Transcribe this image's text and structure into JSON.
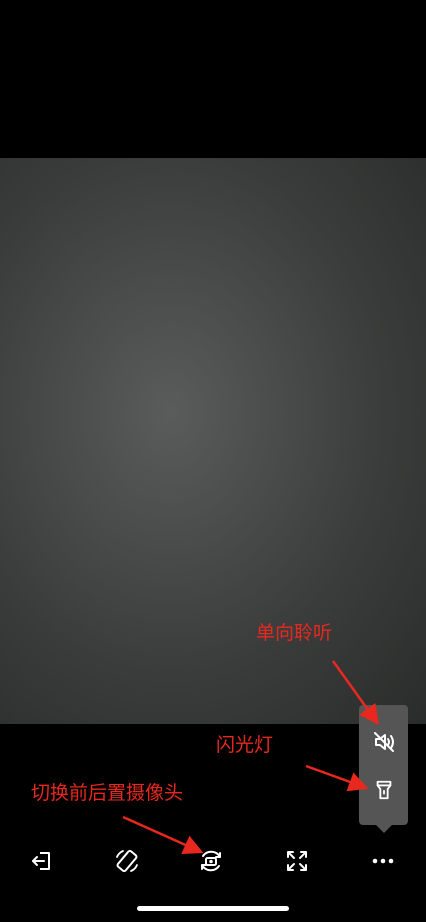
{
  "annotations": {
    "one_way_listen": "单向聆听",
    "flashlight": "闪光灯",
    "switch_camera": "切换前后置摄像头"
  },
  "floating_menu": {
    "items": [
      {
        "name": "one-way-listen",
        "icon": "speaker-muted-icon"
      },
      {
        "name": "flashlight",
        "icon": "flashlight-icon"
      }
    ]
  },
  "toolbar": {
    "items": [
      {
        "name": "exit",
        "icon": "exit-icon"
      },
      {
        "name": "rotate",
        "icon": "rotate-screen-icon"
      },
      {
        "name": "switch-camera",
        "icon": "switch-camera-icon"
      },
      {
        "name": "fullscreen",
        "icon": "fullscreen-icon"
      },
      {
        "name": "more",
        "icon": "more-dots-icon"
      }
    ]
  },
  "colors": {
    "annotation": "#e8281e",
    "menu_background": "#555555",
    "icon": "#ffffff"
  }
}
